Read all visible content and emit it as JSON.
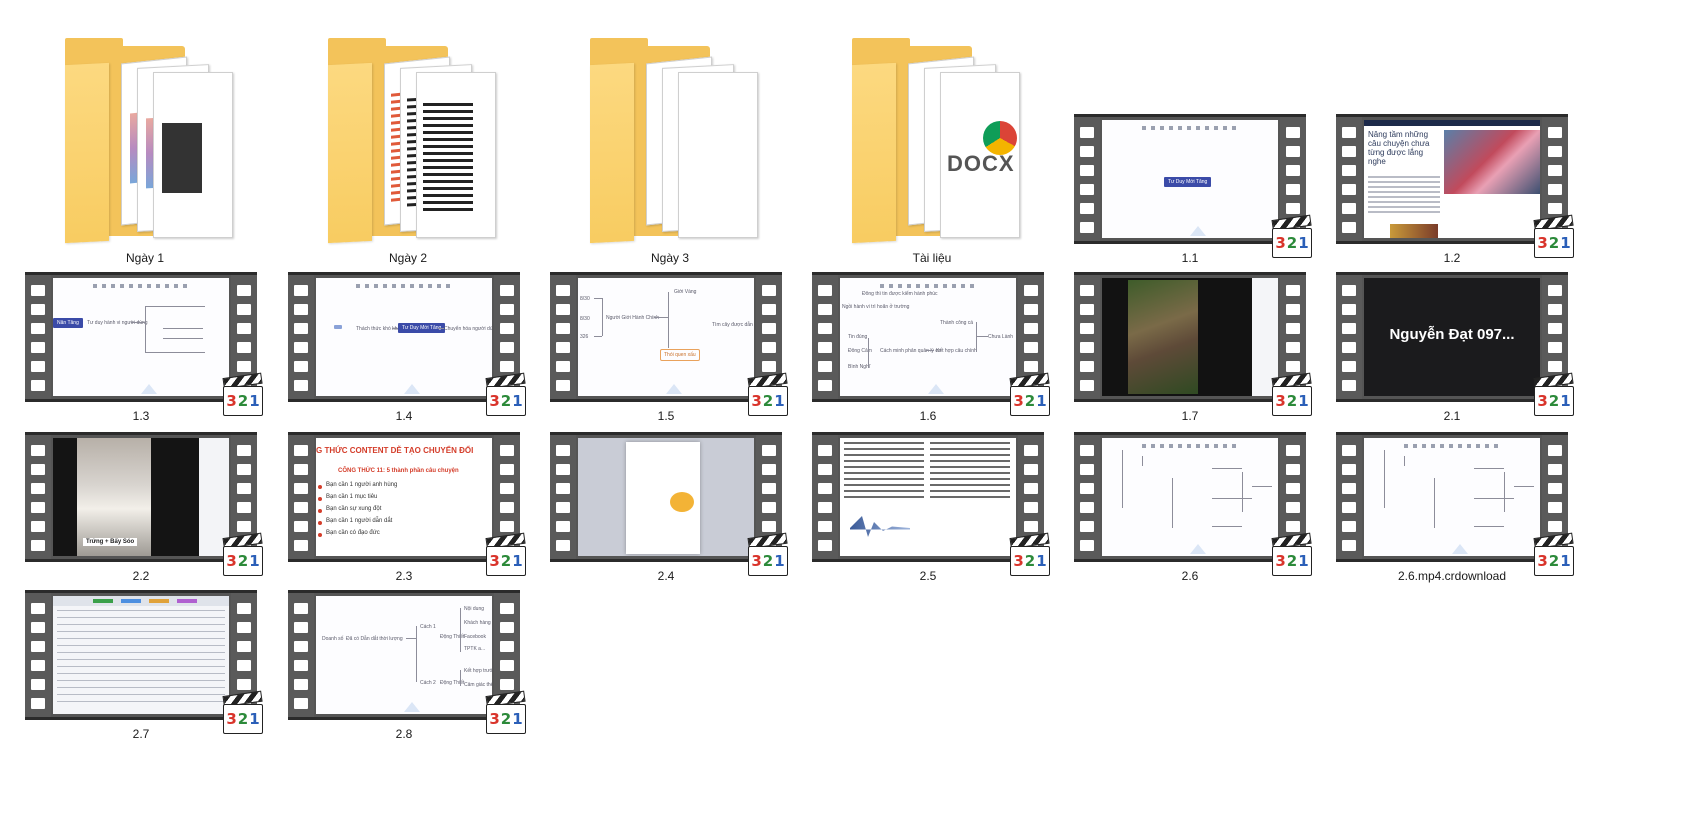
{
  "items": [
    {
      "type": "folder",
      "label": "Ngày 1",
      "preview": "screens"
    },
    {
      "type": "folder",
      "label": "Ngày 2",
      "preview": "doc"
    },
    {
      "type": "folder",
      "label": "Ngày 3",
      "preview": "blank"
    },
    {
      "type": "folder",
      "label": "Tài liệu",
      "preview": "docx",
      "docx_text": "DOCX"
    },
    {
      "type": "video",
      "label": "1.1",
      "content": "button",
      "button_text": "Tư Duy Mới Tăng"
    },
    {
      "type": "video",
      "label": "1.2",
      "content": "article",
      "headline": "Nâng tầm những câu chuyện chưa từng được lắng nghe"
    },
    {
      "type": "video",
      "label": "1.3",
      "content": "mindmap-left",
      "node": "Năn Tăng",
      "center": "Tư duy hành vi người dùng"
    },
    {
      "type": "video",
      "label": "1.4",
      "content": "mindmap-center",
      "left": "Thách thức khó khăn",
      "center": "Tư Duy Mới Tăng",
      "right": "Chuyển hóa người dùng"
    },
    {
      "type": "video",
      "label": "1.5",
      "content": "mindmap-15",
      "n1": "8/30",
      "n2": "8/30",
      "n3": "326",
      "center": "Người Giới Hành Chính",
      "top": "Giới Vàng",
      "right": "Tìm cây được dẫn",
      "bottom": "Thói quen xấu"
    },
    {
      "type": "video",
      "label": "1.6",
      "content": "mindmap-16",
      "n1": "Đông thì tin được kiểm hành phúc",
      "n2": "Ngồi hành vi trì hoãn ở trường",
      "n3": "Tin đúng",
      "n4": "Đông Cảm",
      "n5": "Bình Nghĩ",
      "c1": "Cách minh phản quản lý cơ",
      "c2": "Kết hợp câu chính",
      "r1": "Thành công cá",
      "r2": "Chưa Lành"
    },
    {
      "type": "video",
      "label": "1.7",
      "content": "photo"
    },
    {
      "type": "video",
      "label": "2.1",
      "content": "dark-title",
      "title": "Nguyễn Đạt 097..."
    },
    {
      "type": "video",
      "label": "2.2",
      "content": "phone",
      "caption": "Trứng + Bấy Sóo"
    },
    {
      "type": "video",
      "label": "2.3",
      "content": "slide",
      "title": "G THỨC CONTENT DỄ TẠO CHUYỂN ĐỔI",
      "subtitle": "CÔNG THỨC 11: 5 thành phần câu chuyện",
      "bullets": [
        "Bạn cần 1 người anh hùng",
        "Bạn cần 1 mục tiêu",
        "Bạn cần sự xung đột",
        "Bạn cần 1 người dẫn dắt",
        "Bạn cần có đạo đức"
      ]
    },
    {
      "type": "video",
      "label": "2.4",
      "content": "dialog"
    },
    {
      "type": "video",
      "label": "2.5",
      "content": "textdoc"
    },
    {
      "type": "video",
      "label": "2.6",
      "content": "tree"
    },
    {
      "type": "video",
      "label": "2.6.mp4.crdownload",
      "content": "tree"
    },
    {
      "type": "video",
      "label": "2.7",
      "content": "table"
    },
    {
      "type": "video",
      "label": "2.8",
      "content": "mindmap-28",
      "n1": "Doanh số",
      "n2": "Đã có Dẫn dắt thời lượng",
      "a": "Cách 1",
      "b": "Cách 2",
      "x": "Động Thiết",
      "y": "Động Thiết",
      "leaves": [
        "Nội dung",
        "Khách hàng",
        "Facebook",
        "TPTK a...",
        "Kết hợp trước",
        "Cảm giác thẻ ngay"
      ]
    }
  ],
  "clapper_text": {
    "d1": "3",
    "d2": "2",
    "d3": "1"
  },
  "colors": {
    "folder": "#f3c35a",
    "d3": "#d9342b",
    "d2": "#2c8a3a",
    "d1": "#2b5fb8"
  }
}
